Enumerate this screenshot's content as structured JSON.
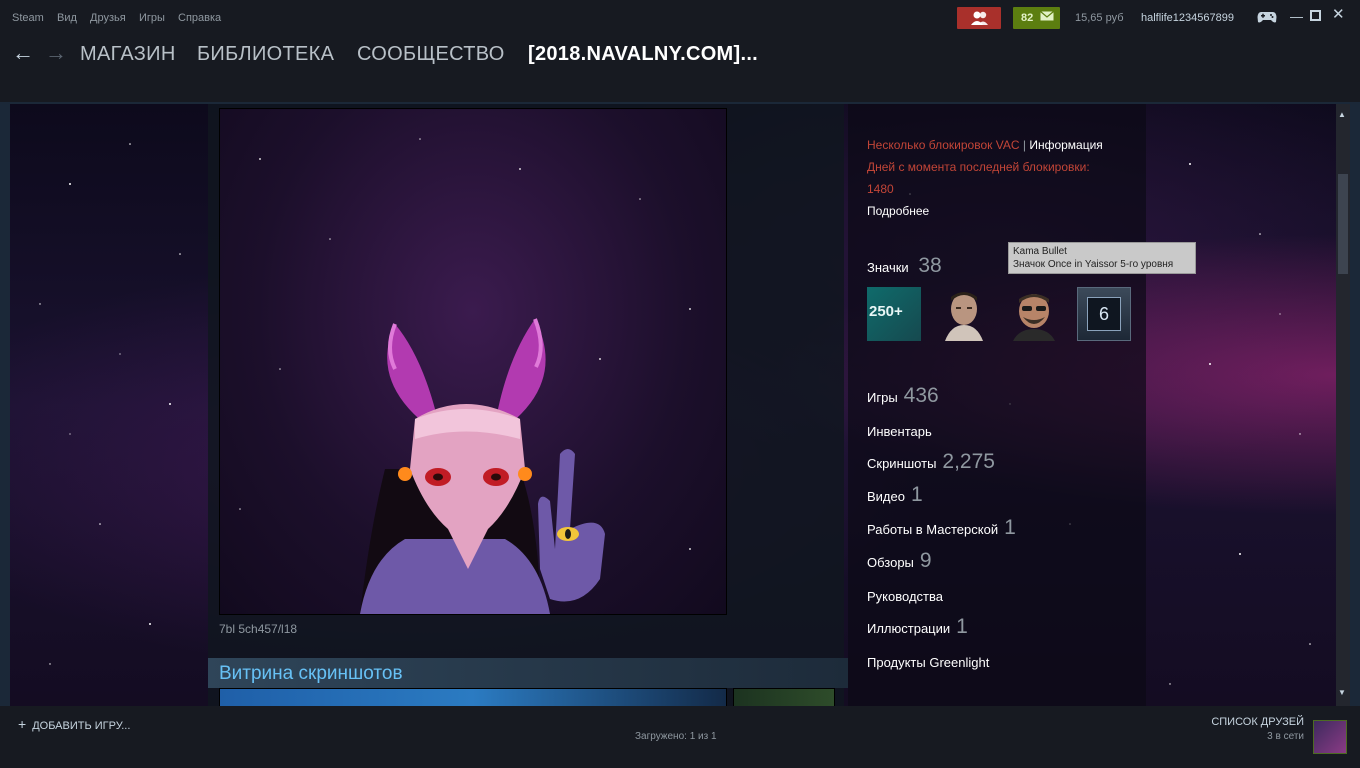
{
  "menubar": {
    "items": [
      "Steam",
      "Вид",
      "Друзья",
      "Игры",
      "Справка"
    ],
    "message_count": "82",
    "wallet": "15,65 руб",
    "username": "halflife1234567899"
  },
  "nav": {
    "store": "МАГАЗИН",
    "library": "БИБЛИОТЕКА",
    "community": "СООБЩЕСТВО",
    "profile": "[2018.NAVALNY.COM]..."
  },
  "profile": {
    "artwork_caption": "7bl 5ch457/l18",
    "showcase_title": "Витрина скриншотов",
    "vac_text": "Несколько блокировок VAC",
    "vac_sep": "|",
    "vac_info": "Информация",
    "days_label": "Дней с момента последней блокировки:",
    "days_value": "1480",
    "more": "Подробнее",
    "badges_label": "Значки",
    "badges_count": "38",
    "badge1_text": "250+",
    "badge4_text": "6",
    "tooltip_title": "Kama Bullet",
    "tooltip_text": "Значок Once in Yaissor 5-го уровня",
    "stats": [
      {
        "label": "Игры",
        "value": "436"
      },
      {
        "label": "Инвентарь",
        "value": ""
      },
      {
        "label": "Скриншоты",
        "value": "2,275"
      },
      {
        "label": "Видео",
        "value": "1"
      },
      {
        "label": "Работы в Мастерской",
        "value": "1"
      },
      {
        "label": "Обзоры",
        "value": "9"
      },
      {
        "label": "Руководства",
        "value": ""
      },
      {
        "label": "Иллюстрации",
        "value": "1"
      },
      {
        "label": "Продукты Greenlight",
        "value": ""
      }
    ]
  },
  "bottom": {
    "add_game": "ДОБАВИТЬ ИГРУ...",
    "loaded": "Загружено: 1 из 1",
    "friends_list": "СПИСОК ДРУЗЕЙ",
    "online": "3 в сети"
  },
  "colors": {
    "accent": "#67c1f5",
    "vac_red": "#c24537",
    "friends_notif": "#a9302b",
    "msg_notif": "#5c7e10"
  }
}
